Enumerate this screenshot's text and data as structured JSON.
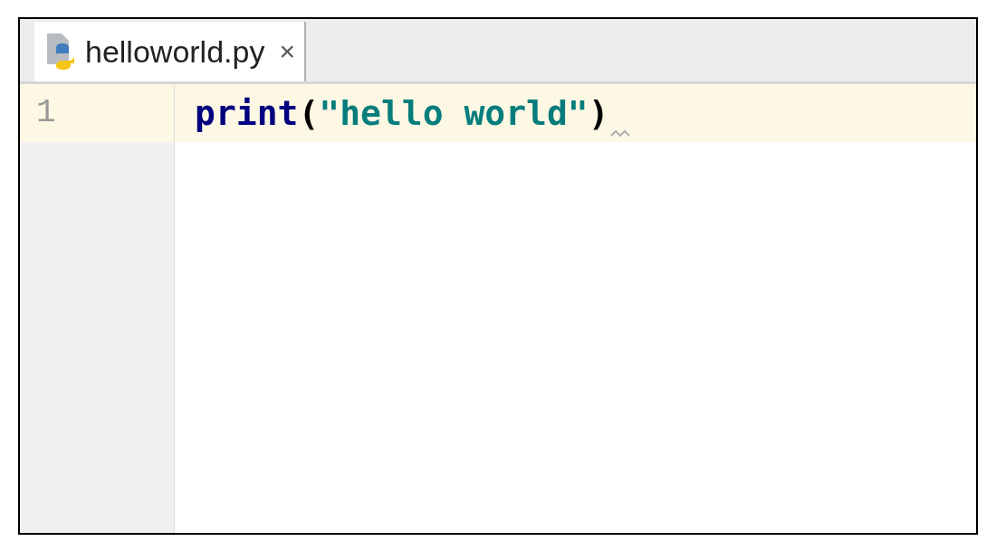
{
  "tabs": [
    {
      "label": "helloworld.py",
      "close": "×",
      "selected": true
    }
  ],
  "editor": {
    "lines": [
      {
        "number": "1",
        "current": true,
        "tokens": [
          {
            "kind": "function",
            "text": "print"
          },
          {
            "kind": "punct",
            "text": "("
          },
          {
            "kind": "string",
            "text": "\"hello world\""
          },
          {
            "kind": "punct",
            "text": ")"
          }
        ]
      }
    ]
  }
}
